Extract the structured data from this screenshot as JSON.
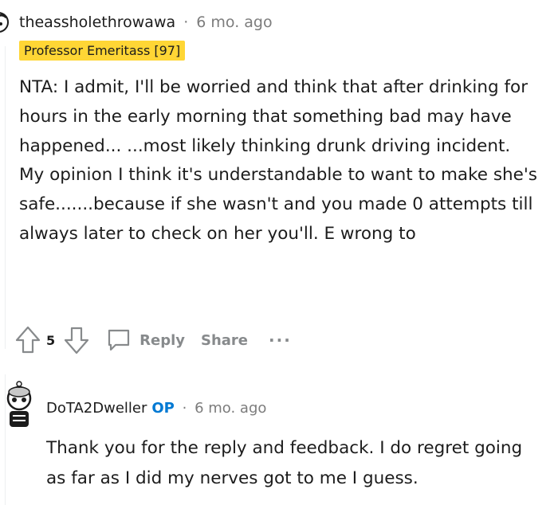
{
  "comment1": {
    "username": "theassholethrowawa",
    "separator": "·",
    "time": "6 mo. ago",
    "flair": "Professor Emeritass [97]",
    "body": "NTA: I admit, I'll be worried and think that after drinking for hours in the early morning that something bad may have happened... ...most likely thinking drunk driving incident. My opinion I think it's understandable to want to make she's safe.......because if she wasn't and you made 0 attempts till always later to check on her you'll. E wrong to",
    "actions": {
      "vote_count": "5",
      "reply_label": "Reply",
      "share_label": "Share",
      "more_label": "···"
    }
  },
  "comment2": {
    "username": "DoTA2Dweller",
    "op_badge": "OP",
    "separator": "·",
    "time": "6 mo. ago",
    "body": "Thank you for the reply and feedback. I do regret going as far as I did my nerves got to me I guess."
  },
  "colors": {
    "flair_bg": "#ffd635",
    "op_blue": "#0079d3",
    "muted_gray": "#878a8c"
  }
}
